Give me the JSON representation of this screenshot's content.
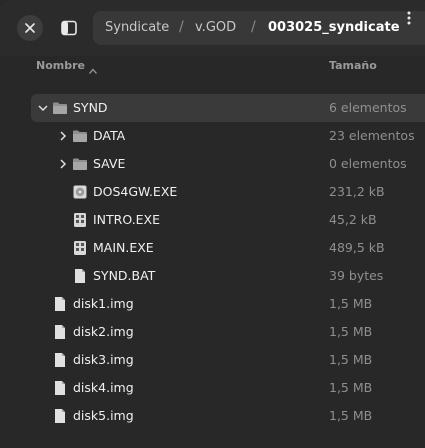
{
  "header": {
    "close_icon": "close-icon",
    "sidebar_icon": "sidebar-toggle-icon",
    "breadcrumbs": [
      "Syndicate",
      "v.GOD",
      "003025_syndicate"
    ],
    "separators": [
      "/",
      "/"
    ],
    "menu_icon": "vertical-ellipsis-icon"
  },
  "columns": {
    "name": "Nombre",
    "size": "Tamaño",
    "sort_icon": "sort-ascending-icon"
  },
  "rows": [
    {
      "name": "SYND",
      "size": "6 elementos",
      "type": "folder",
      "expanded": true,
      "selected": true
    },
    {
      "name": "DATA",
      "size": "23 elementos",
      "type": "folder",
      "expanded": false
    },
    {
      "name": "SAVE",
      "size": "0 elementos",
      "type": "folder",
      "expanded": false
    },
    {
      "name": "DOS4GW.EXE",
      "size": "231,2 kB",
      "type": "executable-disc"
    },
    {
      "name": "INTRO.EXE",
      "size": "45,2 kB",
      "type": "executable"
    },
    {
      "name": "MAIN.EXE",
      "size": "489,5 kB",
      "type": "executable"
    },
    {
      "name": "SYND.BAT",
      "size": "39 bytes",
      "type": "document"
    },
    {
      "name": "disk1.img",
      "size": "1,5 MB",
      "type": "file"
    },
    {
      "name": "disk2.img",
      "size": "1,5 MB",
      "type": "file"
    },
    {
      "name": "disk3.img",
      "size": "1,5 MB",
      "type": "file"
    },
    {
      "name": "disk4.img",
      "size": "1,5 MB",
      "type": "file"
    },
    {
      "name": "disk5.img",
      "size": "1,5 MB",
      "type": "file"
    }
  ],
  "colors": {
    "background": "#282828",
    "selected_row": "#3a3a3a",
    "text": "#f0f0f0",
    "muted_text": "#8f8f8f"
  }
}
